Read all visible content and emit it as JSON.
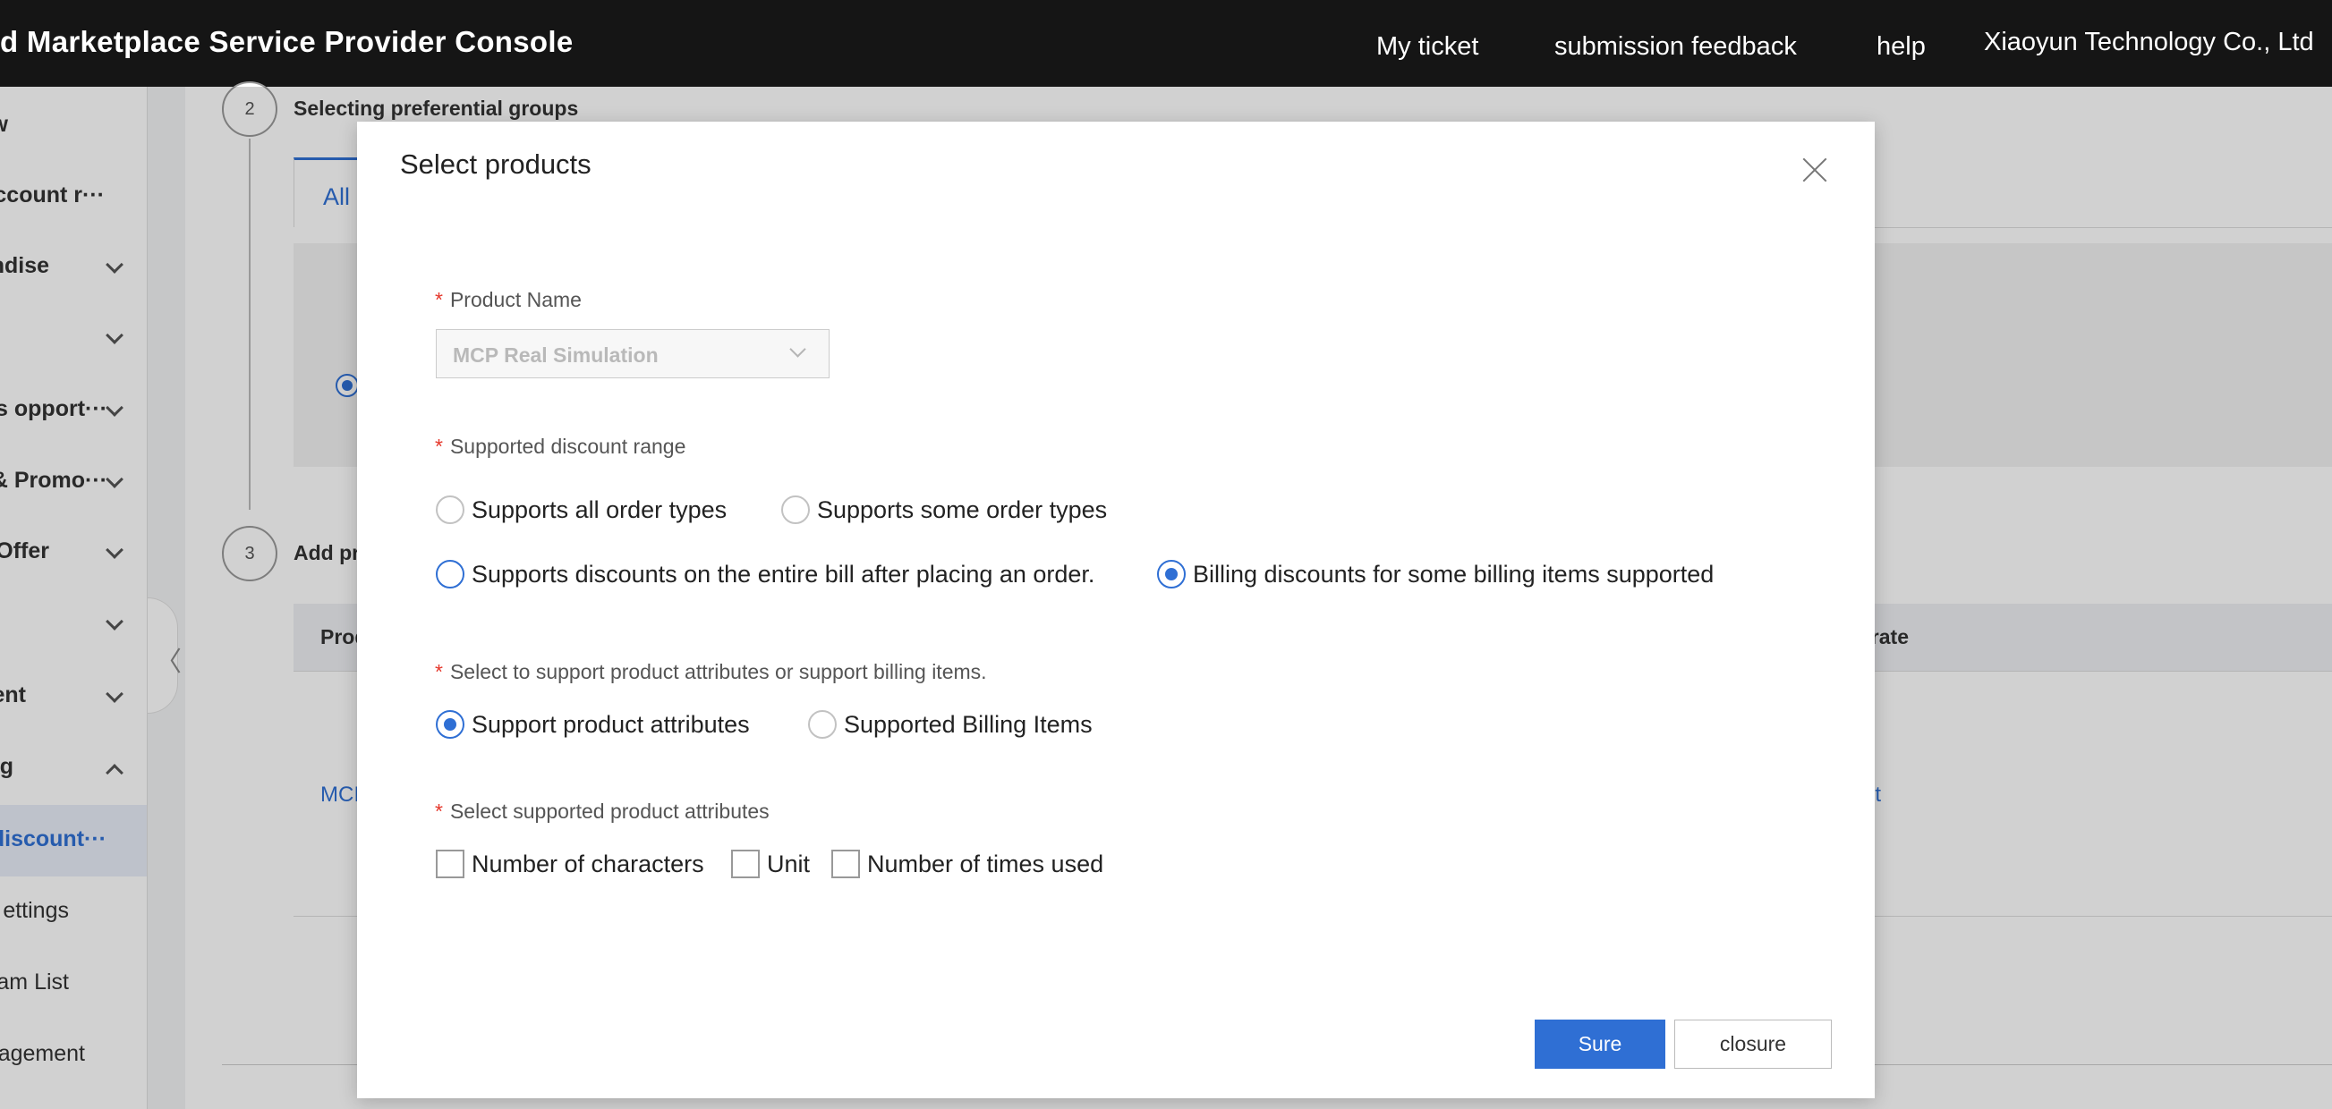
{
  "header": {
    "brand": "d Marketplace Service Provider Console",
    "nav": [
      "My ticket",
      "submission feedback",
      "help"
    ],
    "company": "Xiaoyun Technology Co., Ltd"
  },
  "sidebar": {
    "items": [
      {
        "label": "w"
      },
      {
        "label": "ccount r···"
      },
      {
        "label": "ndise"
      },
      {
        "label": ""
      },
      {
        "label": "s opport···"
      },
      {
        "label": "& Promo···"
      },
      {
        "label": "Offer"
      },
      {
        "label": ""
      },
      {
        "label": "ent"
      },
      {
        "label": "g"
      },
      {
        "label": "discount···"
      },
      {
        "label": "ettings"
      },
      {
        "label": "am List"
      },
      {
        "label": "agement"
      }
    ],
    "collapse_glyph": "〈"
  },
  "background": {
    "step2_number": "2",
    "step2_title": "Selecting preferential groups",
    "tab_all": "All",
    "step3_number": "3",
    "step3_title": "Add pr",
    "table_col_product": "Prod",
    "table_col_operate": "erate",
    "row_product": "MCI",
    "row_action": "it"
  },
  "modal": {
    "title": "Select products",
    "product_name": {
      "label": "Product Name",
      "value": "MCP Real Simulation"
    },
    "discount_range": {
      "label": "Supported discount range",
      "options": [
        {
          "label": "Supports all order types",
          "selected": false
        },
        {
          "label": "Supports some order types",
          "selected": false
        },
        {
          "label": "Supports discounts on the entire bill after placing an order.",
          "selected": false
        },
        {
          "label": "Billing discounts for some billing items supported",
          "selected": true
        }
      ]
    },
    "support_type": {
      "label": "Select to support product attributes or support billing items.",
      "options": [
        {
          "label": "Support product attributes",
          "selected": true
        },
        {
          "label": "Supported Billing Items",
          "selected": false
        }
      ]
    },
    "attributes": {
      "label": "Select supported product attributes",
      "options": [
        {
          "label": "Number of characters",
          "checked": false
        },
        {
          "label": "Unit",
          "checked": false
        },
        {
          "label": "Number of times used",
          "checked": false
        }
      ]
    },
    "buttons": {
      "sure": "Sure",
      "closure": "closure"
    },
    "required_mark": "*"
  },
  "colors": {
    "accent": "#2f6fd4",
    "topbar": "#151515",
    "required": "#e5372b"
  }
}
